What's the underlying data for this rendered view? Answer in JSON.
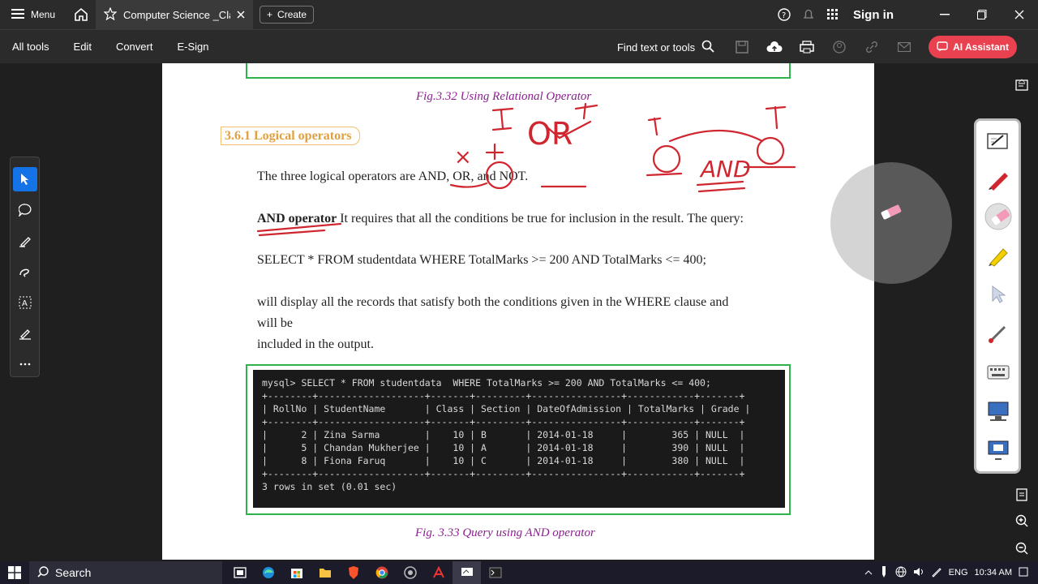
{
  "titlebar": {
    "menu_label": "Menu",
    "tab_title": "Computer Science _Clas...",
    "create_label": "Create",
    "sign_in_label": "Sign in"
  },
  "toolbar": {
    "items": [
      "All tools",
      "Edit",
      "Convert",
      "E-Sign"
    ],
    "find_label": "Find text or tools",
    "ai_label": "AI Assistant"
  },
  "document": {
    "fig_332_caption": "Fig.3.32 Using Relational Operator",
    "section_title": "3.6.1 Logical operators",
    "intro_text": "The three logical operators are AND, OR, and NOT.",
    "and_heading": "AND operator",
    "and_desc": " It requires that all the conditions be true for inclusion in the result. The query:",
    "query_text": "SELECT * FROM studentdata WHERE TotalMarks >= 200 AND TotalMarks <= 400;",
    "display_line1": "will display all the records that satisfy both the conditions given in the WHERE clause and",
    "display_line2": "will be",
    "display_line3": "included in the output.",
    "terminal": {
      "command": "mysql> SELECT * FROM studentdata  WHERE TotalMarks >= 200 AND TotalMarks <= 400;",
      "border": "+--------+-------------------+-------+---------+----------------+------------+-------+",
      "header": "| RollNo | StudentName       | Class | Section | DateOfAdmission | TotalMarks | Grade |",
      "rows": [
        "|      2 | Zina Sarma        |    10 | B       | 2014-01-18     |        365 | NULL  |",
        "|      5 | Chandan Mukherjee |    10 | A       | 2014-01-18     |        390 | NULL  |",
        "|      8 | Fiona Faruq       |    10 | C       | 2014-01-18     |        380 | NULL  |"
      ],
      "footer": "3 rows in set (0.01 sec)"
    },
    "fig_333_caption": "Fig. 3.33 Query using AND operator"
  },
  "annotations": {
    "or_word": "OR",
    "and_word": "AND",
    "t_left": "T",
    "t_right": "T",
    "cross": "×"
  },
  "taskbar": {
    "search_label": "Search",
    "lang": "ENG",
    "time": "10:34 AM"
  },
  "colors": {
    "accent": "#1473e6",
    "ai_button": "#e9414f",
    "figure_border": "#2db34a",
    "caption": "#8a1f8f",
    "section": "#e0a040",
    "ink": "#d0262f"
  }
}
